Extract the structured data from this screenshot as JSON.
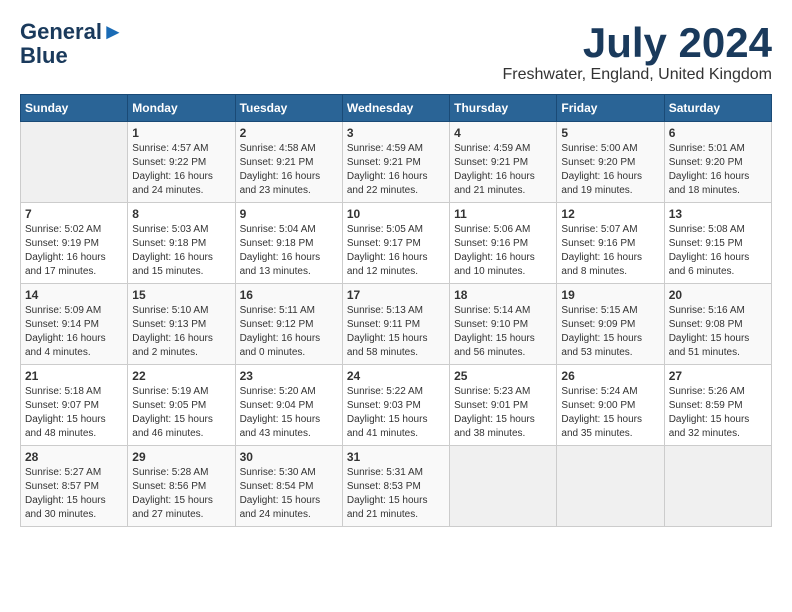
{
  "header": {
    "logo_line1": "General",
    "logo_line2": "Blue",
    "month_year": "July 2024",
    "location": "Freshwater, England, United Kingdom"
  },
  "days_of_week": [
    "Sunday",
    "Monday",
    "Tuesday",
    "Wednesday",
    "Thursday",
    "Friday",
    "Saturday"
  ],
  "weeks": [
    [
      {
        "day": "",
        "info": ""
      },
      {
        "day": "1",
        "info": "Sunrise: 4:57 AM\nSunset: 9:22 PM\nDaylight: 16 hours\nand 24 minutes."
      },
      {
        "day": "2",
        "info": "Sunrise: 4:58 AM\nSunset: 9:21 PM\nDaylight: 16 hours\nand 23 minutes."
      },
      {
        "day": "3",
        "info": "Sunrise: 4:59 AM\nSunset: 9:21 PM\nDaylight: 16 hours\nand 22 minutes."
      },
      {
        "day": "4",
        "info": "Sunrise: 4:59 AM\nSunset: 9:21 PM\nDaylight: 16 hours\nand 21 minutes."
      },
      {
        "day": "5",
        "info": "Sunrise: 5:00 AM\nSunset: 9:20 PM\nDaylight: 16 hours\nand 19 minutes."
      },
      {
        "day": "6",
        "info": "Sunrise: 5:01 AM\nSunset: 9:20 PM\nDaylight: 16 hours\nand 18 minutes."
      }
    ],
    [
      {
        "day": "7",
        "info": "Sunrise: 5:02 AM\nSunset: 9:19 PM\nDaylight: 16 hours\nand 17 minutes."
      },
      {
        "day": "8",
        "info": "Sunrise: 5:03 AM\nSunset: 9:18 PM\nDaylight: 16 hours\nand 15 minutes."
      },
      {
        "day": "9",
        "info": "Sunrise: 5:04 AM\nSunset: 9:18 PM\nDaylight: 16 hours\nand 13 minutes."
      },
      {
        "day": "10",
        "info": "Sunrise: 5:05 AM\nSunset: 9:17 PM\nDaylight: 16 hours\nand 12 minutes."
      },
      {
        "day": "11",
        "info": "Sunrise: 5:06 AM\nSunset: 9:16 PM\nDaylight: 16 hours\nand 10 minutes."
      },
      {
        "day": "12",
        "info": "Sunrise: 5:07 AM\nSunset: 9:16 PM\nDaylight: 16 hours\nand 8 minutes."
      },
      {
        "day": "13",
        "info": "Sunrise: 5:08 AM\nSunset: 9:15 PM\nDaylight: 16 hours\nand 6 minutes."
      }
    ],
    [
      {
        "day": "14",
        "info": "Sunrise: 5:09 AM\nSunset: 9:14 PM\nDaylight: 16 hours\nand 4 minutes."
      },
      {
        "day": "15",
        "info": "Sunrise: 5:10 AM\nSunset: 9:13 PM\nDaylight: 16 hours\nand 2 minutes."
      },
      {
        "day": "16",
        "info": "Sunrise: 5:11 AM\nSunset: 9:12 PM\nDaylight: 16 hours\nand 0 minutes."
      },
      {
        "day": "17",
        "info": "Sunrise: 5:13 AM\nSunset: 9:11 PM\nDaylight: 15 hours\nand 58 minutes."
      },
      {
        "day": "18",
        "info": "Sunrise: 5:14 AM\nSunset: 9:10 PM\nDaylight: 15 hours\nand 56 minutes."
      },
      {
        "day": "19",
        "info": "Sunrise: 5:15 AM\nSunset: 9:09 PM\nDaylight: 15 hours\nand 53 minutes."
      },
      {
        "day": "20",
        "info": "Sunrise: 5:16 AM\nSunset: 9:08 PM\nDaylight: 15 hours\nand 51 minutes."
      }
    ],
    [
      {
        "day": "21",
        "info": "Sunrise: 5:18 AM\nSunset: 9:07 PM\nDaylight: 15 hours\nand 48 minutes."
      },
      {
        "day": "22",
        "info": "Sunrise: 5:19 AM\nSunset: 9:05 PM\nDaylight: 15 hours\nand 46 minutes."
      },
      {
        "day": "23",
        "info": "Sunrise: 5:20 AM\nSunset: 9:04 PM\nDaylight: 15 hours\nand 43 minutes."
      },
      {
        "day": "24",
        "info": "Sunrise: 5:22 AM\nSunset: 9:03 PM\nDaylight: 15 hours\nand 41 minutes."
      },
      {
        "day": "25",
        "info": "Sunrise: 5:23 AM\nSunset: 9:01 PM\nDaylight: 15 hours\nand 38 minutes."
      },
      {
        "day": "26",
        "info": "Sunrise: 5:24 AM\nSunset: 9:00 PM\nDaylight: 15 hours\nand 35 minutes."
      },
      {
        "day": "27",
        "info": "Sunrise: 5:26 AM\nSunset: 8:59 PM\nDaylight: 15 hours\nand 32 minutes."
      }
    ],
    [
      {
        "day": "28",
        "info": "Sunrise: 5:27 AM\nSunset: 8:57 PM\nDaylight: 15 hours\nand 30 minutes."
      },
      {
        "day": "29",
        "info": "Sunrise: 5:28 AM\nSunset: 8:56 PM\nDaylight: 15 hours\nand 27 minutes."
      },
      {
        "day": "30",
        "info": "Sunrise: 5:30 AM\nSunset: 8:54 PM\nDaylight: 15 hours\nand 24 minutes."
      },
      {
        "day": "31",
        "info": "Sunrise: 5:31 AM\nSunset: 8:53 PM\nDaylight: 15 hours\nand 21 minutes."
      },
      {
        "day": "",
        "info": ""
      },
      {
        "day": "",
        "info": ""
      },
      {
        "day": "",
        "info": ""
      }
    ]
  ]
}
